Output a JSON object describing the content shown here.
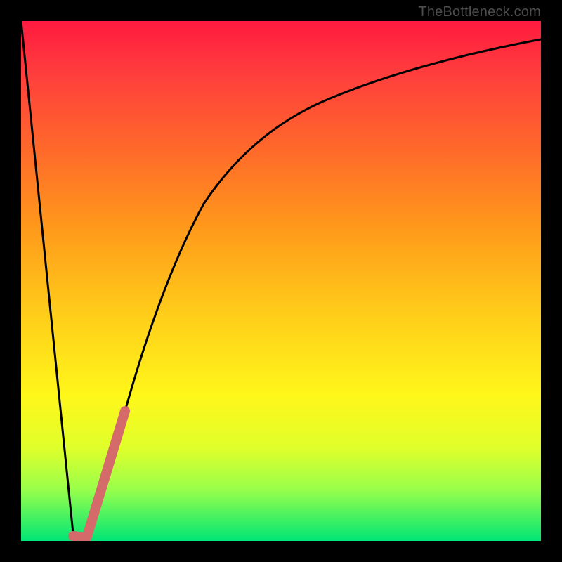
{
  "credit": "TheBottleneck.com",
  "colors": {
    "frame": "#000000",
    "curve": "#000000",
    "highlight": "#d46a6a"
  },
  "chart_data": {
    "type": "line",
    "title": "",
    "xlabel": "",
    "ylabel": "",
    "xlim": [
      0,
      100
    ],
    "ylim": [
      0,
      100
    ],
    "series": [
      {
        "name": "curve",
        "x": [
          0,
          10,
          12.5,
          15,
          20,
          25,
          30,
          40,
          50,
          60,
          70,
          80,
          90,
          100
        ],
        "values": [
          100,
          1,
          0,
          2,
          25,
          48,
          62,
          78,
          85,
          89,
          92,
          94,
          95.5,
          96.5
        ]
      }
    ],
    "annotations": [
      {
        "name": "highlight-segment",
        "x": [
          12.5,
          20
        ],
        "values": [
          0,
          25
        ]
      },
      {
        "name": "highlight-minimum",
        "x": [
          10,
          12.5
        ],
        "values": [
          1,
          0
        ]
      }
    ]
  }
}
